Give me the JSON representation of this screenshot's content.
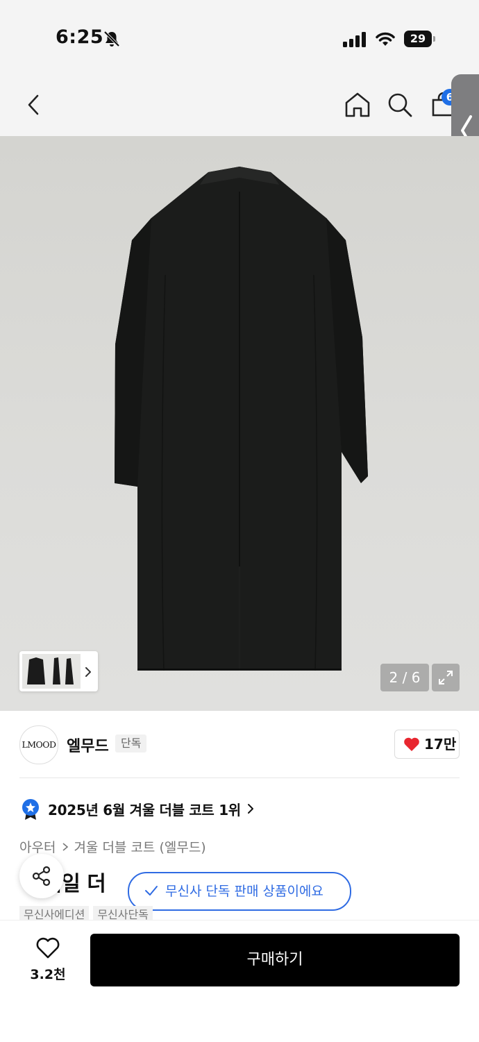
{
  "status_bar": {
    "time": "6:25",
    "battery_level": "29",
    "icons": [
      "bell-slash-icon",
      "signal-icon",
      "wifi-icon",
      "battery-icon"
    ]
  },
  "header": {
    "icons": [
      "back-icon",
      "home-icon",
      "search-icon",
      "bag-icon"
    ],
    "cart_badge": "6"
  },
  "gallery": {
    "counter": "2 / 6",
    "current_index": 2,
    "total": 6
  },
  "brand": {
    "logo_text": "LMOOD",
    "name": "엘무드",
    "tag": "단독",
    "likes": "17만"
  },
  "ranking": {
    "text": "2025년 6월 겨울 더블 코트 1위"
  },
  "category": {
    "level1": "아우터",
    "level2": "겨울 더블 코트 (엘무드)"
  },
  "product": {
    "title_visible": "이웨일 더"
  },
  "toast": {
    "text": "무신사 단독 판매 상품이에요"
  },
  "tags": [
    "무신사에디션",
    "무신사단독"
  ],
  "bottom_bar": {
    "wishlist_count": "3.2천",
    "buy_label": "구매하기"
  },
  "colors": {
    "accent_blue": "#2f6be3",
    "like_red": "#e8262f",
    "buy_button": "#000000",
    "badge_blue": "#1f6fe6"
  }
}
